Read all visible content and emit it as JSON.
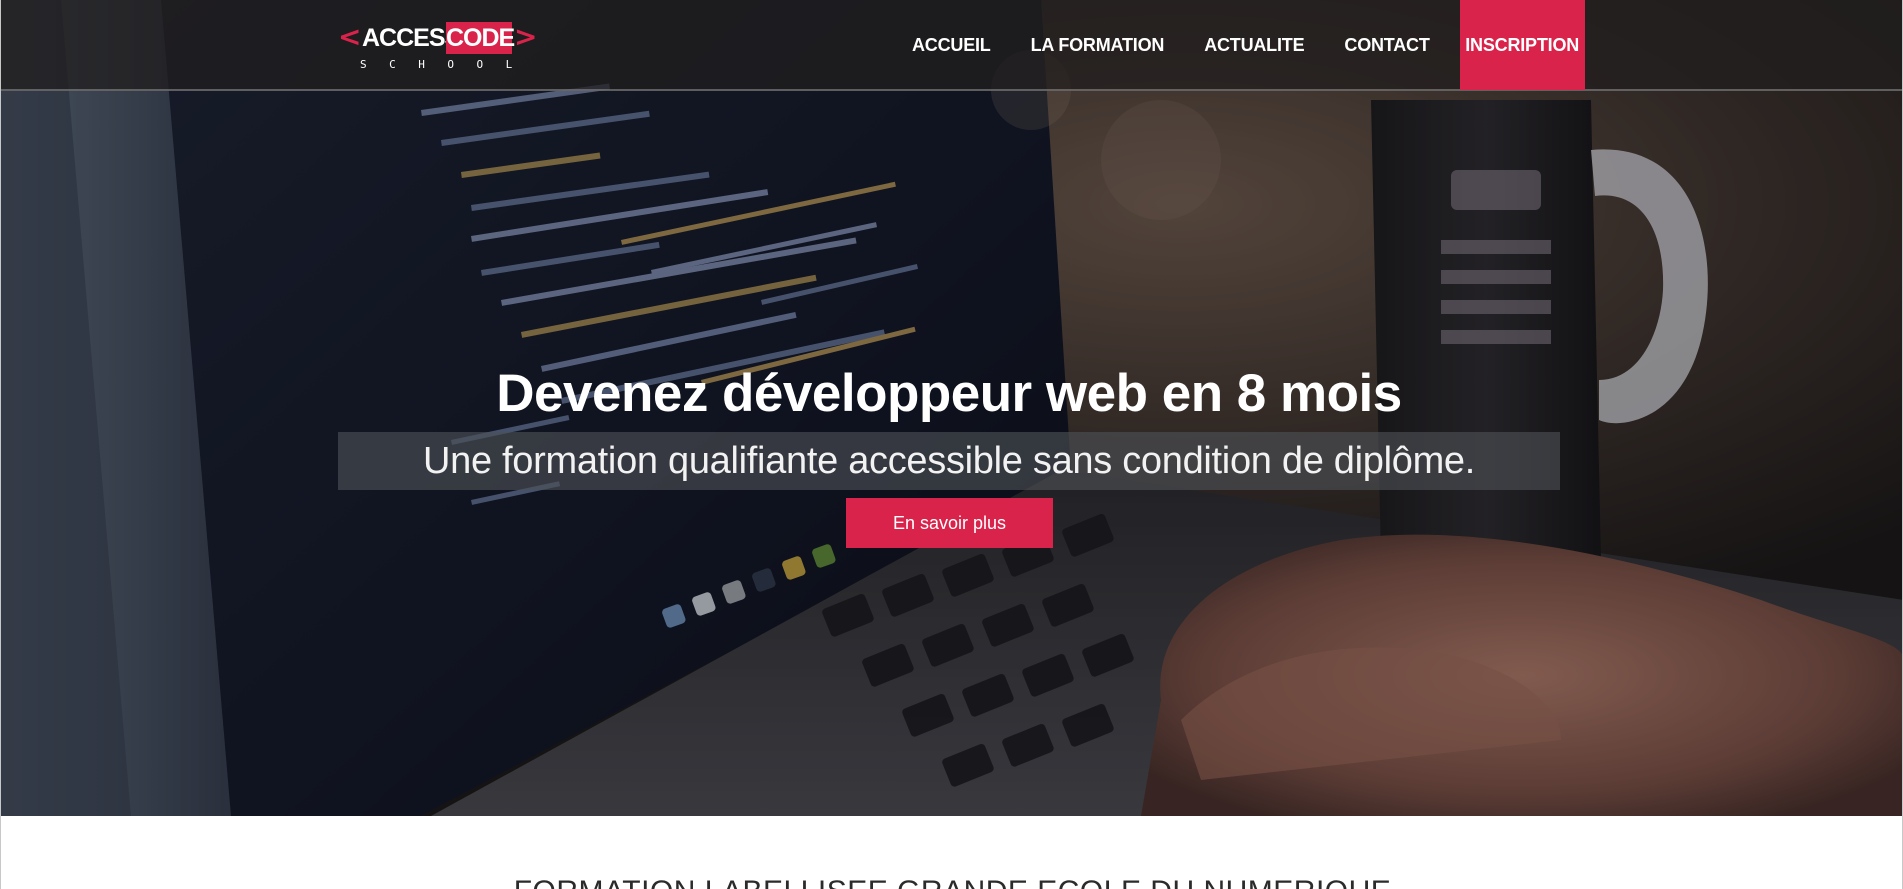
{
  "brand": {
    "bracket_left": "<",
    "bracket_right": ">",
    "word_access": "ACCESS",
    "word_code": "CODE",
    "word_school": "SCHOOL"
  },
  "nav": {
    "items": [
      {
        "label": "ACCUEIL"
      },
      {
        "label": "LA FORMATION"
      },
      {
        "label": "ACTUALITE"
      },
      {
        "label": "CONTACT"
      }
    ],
    "cta_label": "INSCRIPTION"
  },
  "hero": {
    "title": "Devenez développeur web en 8 mois",
    "subtitle": "Une formation qualifiante accessible sans condition de diplôme.",
    "button_label": "En savoir plus",
    "background_icon": "laptop-code-photo"
  },
  "section": {
    "title": "FORMATION LABELLISEE GRANDE ECOLE DU NUMERIQUE"
  },
  "colors": {
    "accent": "#d9234a",
    "navbar": "#201e1e",
    "text_light": "#ffffff",
    "text_dark": "#2b2b2b"
  }
}
